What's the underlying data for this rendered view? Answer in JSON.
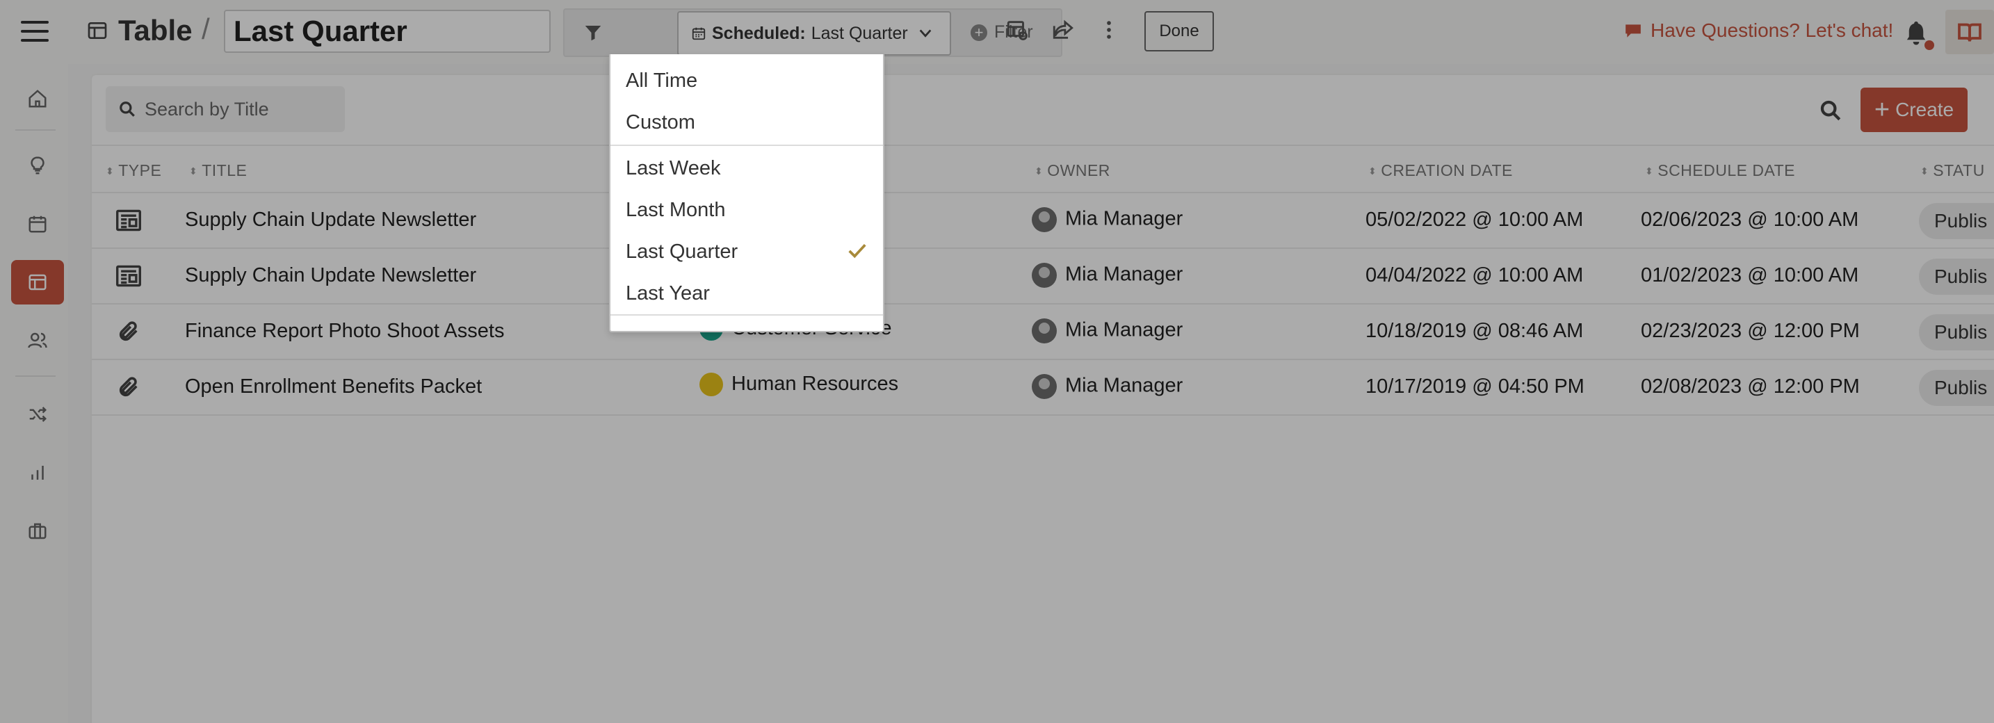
{
  "header": {
    "section_label": "Table",
    "separator": "/",
    "view_name": "Last Quarter",
    "scheduled_label": "Scheduled:",
    "scheduled_value": "Last Quarter",
    "filter_label": "Filter",
    "done_label": "Done",
    "chat_label": "Have Questions? Let's chat!"
  },
  "search": {
    "placeholder": "Search by Title"
  },
  "toolbar": {
    "create_label": "Create"
  },
  "columns": [
    "TYPE",
    "TITLE",
    "OWNER",
    "CREATION DATE",
    "SCHEDULE DATE",
    "STATU"
  ],
  "rows": [
    {
      "type": "newsletter-icon",
      "title": "Supply Chain Update Newsletter",
      "department": "",
      "dept_color": "",
      "owner": "Mia Manager",
      "created": "05/02/2022 @ 10:00 AM",
      "scheduled": "02/06/2023 @ 10:00 AM",
      "status": "Publis"
    },
    {
      "type": "newsletter-icon",
      "title": "Supply Chain Update Newsletter",
      "department": "",
      "dept_color": "",
      "owner": "Mia Manager",
      "created": "04/04/2022 @ 10:00 AM",
      "scheduled": "01/02/2023 @ 10:00 AM",
      "status": "Publis"
    },
    {
      "type": "paperclip-icon",
      "title": "Finance Report Photo Shoot Assets",
      "department": "Customer Service",
      "dept_color": "#1aa58b",
      "owner": "Mia Manager",
      "created": "10/18/2019 @ 08:46 AM",
      "scheduled": "02/23/2023 @ 12:00 PM",
      "status": "Publis"
    },
    {
      "type": "paperclip-icon",
      "title": "Open Enrollment Benefits Packet",
      "department": "Human Resources",
      "dept_color": "#e8c21c",
      "owner": "Mia Manager",
      "created": "10/17/2019 @ 04:50 PM",
      "scheduled": "02/08/2023 @ 12:00 PM",
      "status": "Publis"
    }
  ],
  "dropdown": {
    "options": [
      "All Time",
      "Custom",
      "Last Week",
      "Last Month",
      "Last Quarter",
      "Last Year"
    ],
    "selected": "Last Quarter"
  },
  "colors": {
    "accent": "#c6543f",
    "check": "#a88a3a"
  }
}
